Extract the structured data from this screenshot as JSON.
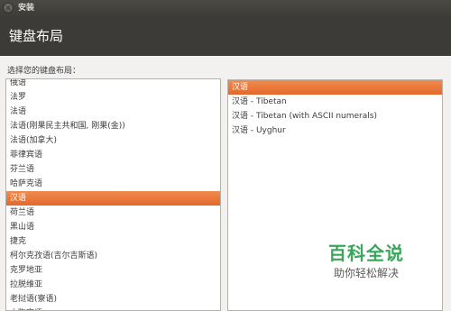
{
  "window": {
    "title": "安装",
    "close_glyph": "×"
  },
  "header": {
    "title": "键盘布局"
  },
  "prompt": "选择您的键盘布局：",
  "layouts": [
    {
      "label": "俄语",
      "selected": false
    },
    {
      "label": "法罗",
      "selected": false
    },
    {
      "label": "法语",
      "selected": false
    },
    {
      "label": "法语(刚果民主共和国, 刚果(金))",
      "selected": false
    },
    {
      "label": "法语(加拿大)",
      "selected": false
    },
    {
      "label": "菲律宾语",
      "selected": false
    },
    {
      "label": "芬兰语",
      "selected": false
    },
    {
      "label": "哈萨克语",
      "selected": false
    },
    {
      "label": "汉语",
      "selected": true
    },
    {
      "label": "荷兰语",
      "selected": false
    },
    {
      "label": "黑山语",
      "selected": false
    },
    {
      "label": "捷克",
      "selected": false
    },
    {
      "label": "柯尔克孜语(吉尔吉斯语)",
      "selected": false
    },
    {
      "label": "克罗地亚",
      "selected": false
    },
    {
      "label": "拉脱维亚",
      "selected": false
    },
    {
      "label": "老挝语(寮语)",
      "selected": false
    },
    {
      "label": "立陶宛语",
      "selected": false
    }
  ],
  "variants": [
    {
      "label": "汉语",
      "selected": true
    },
    {
      "label": "汉语 - Tibetan",
      "selected": false
    },
    {
      "label": "汉语 - Tibetan (with ASCII numerals)",
      "selected": false
    },
    {
      "label": "汉语 - Uyghur",
      "selected": false
    }
  ],
  "watermark": {
    "main": "百科全说",
    "sub": "助你轻松解决"
  },
  "colors": {
    "accent": "#e2692b",
    "header_bg": "#3c3b37",
    "watermark": "#3aa65a"
  }
}
